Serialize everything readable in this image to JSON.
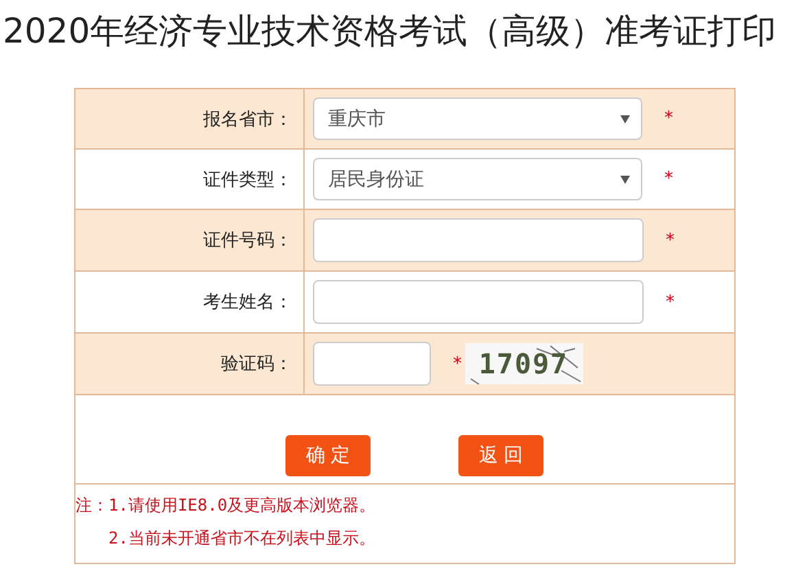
{
  "title": "2020年经济专业技术资格考试（高级）准考证打印",
  "rows": [
    {
      "label": "报名省市：",
      "kind": "select",
      "value": "重庆市",
      "required": "*",
      "shaded": true
    },
    {
      "label": "证件类型：",
      "kind": "select",
      "value": "居民身份证",
      "required": "*",
      "shaded": false
    },
    {
      "label": "证件号码：",
      "kind": "text",
      "required": "*",
      "shaded": true
    },
    {
      "label": "考生姓名：",
      "kind": "text",
      "required": "*",
      "shaded": false
    },
    {
      "label": "验证码：",
      "kind": "captcha",
      "required": "*",
      "captcha": "17097",
      "shaded": true
    }
  ],
  "buttons": [
    "确 定",
    "返 回"
  ],
  "notes": [
    "注：1.请使用IE8.0及更高版本浏览器。",
    "2.当前未开通省市不在列表中显示。"
  ]
}
